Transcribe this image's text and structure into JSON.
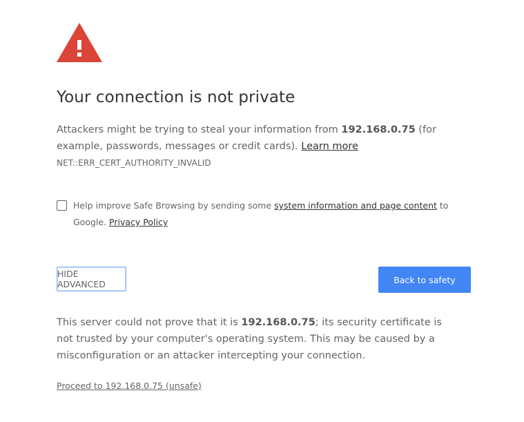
{
  "colors": {
    "warning_red": "#db4437",
    "primary_blue": "#4285f4",
    "focus_blue": "#8ab4f8",
    "text_gray": "#646464",
    "title_color": "#333333"
  },
  "icon": "warning-triangle-icon",
  "title": "Your connection is not private",
  "intro": {
    "text_before": "Attackers might be trying to steal your information from ",
    "host": "192.168.0.75",
    "text_after": " (for example, passwords, messages or credit cards). ",
    "learn_more": "Learn more"
  },
  "error_code": "NET::ERR_CERT_AUTHORITY_INVALID",
  "safe_browsing": {
    "checked": false,
    "text_before": "Help improve Safe Browsing by sending some ",
    "link": "system information and page content",
    "text_middle": " to Google. ",
    "privacy_link": "Privacy Policy"
  },
  "buttons": {
    "hide_advanced": "HIDE ADVANCED",
    "back_to_safety": "Back to safety"
  },
  "advanced": {
    "text_before": "This server could not prove that it is ",
    "host": "192.168.0.75",
    "text_after": "; its security certificate is not trusted by your computer's operating system. This may be caused by a misconfiguration or an attacker intercepting your connection."
  },
  "proceed_link": "Proceed to 192.168.0.75 (unsafe)"
}
